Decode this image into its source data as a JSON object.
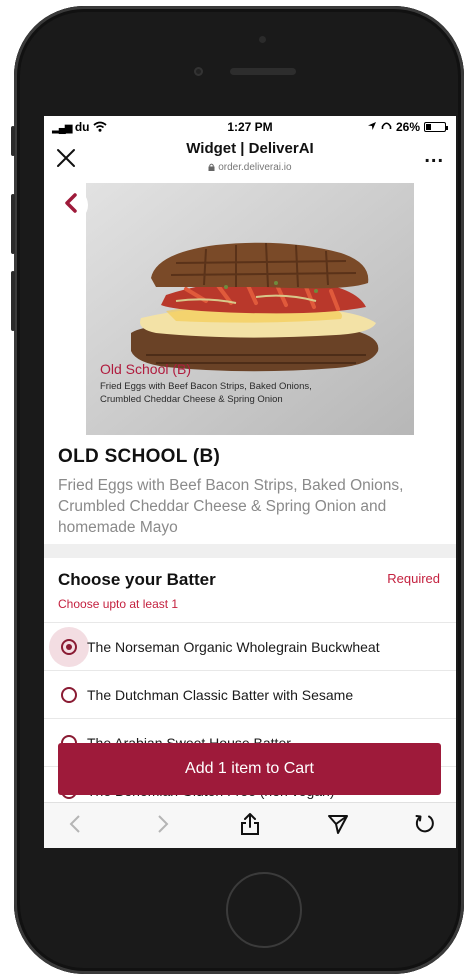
{
  "status_bar": {
    "carrier": "du",
    "time": "1:27 PM",
    "battery": "26%",
    "battery_level": 0.26
  },
  "browser": {
    "title": "Widget | DeliverAI",
    "url": "order.deliverai.io",
    "more_label": "..."
  },
  "hero": {
    "caption_title": "Old School (B)",
    "caption_desc_line1": "Fried Eggs with Beef Bacon Strips, Baked Onions,",
    "caption_desc_line2": "Crumbled Cheddar Cheese & Spring Onion"
  },
  "item": {
    "title": "OLD SCHOOL (B)",
    "description": "Fried Eggs with Beef Bacon Strips, Baked Onions, Crumbled Cheddar Cheese & Spring Onion and homemade Mayo"
  },
  "batter_section": {
    "title": "Choose your Batter",
    "required_label": "Required",
    "subtitle": "Choose upto at least 1",
    "options": [
      {
        "label": "The Norseman Organic Wholegrain Buckwheat",
        "selected": true
      },
      {
        "label": "The Dutchman Classic Batter with Sesame",
        "selected": false
      },
      {
        "label": "The Arabian Sweet House Batter",
        "selected": false
      },
      {
        "label": "The Bohemian Gluten Free (non vegan)",
        "selected": false
      }
    ]
  },
  "cart_button": {
    "label": "Add 1 item to Cart"
  },
  "colors": {
    "brand": "#9e1a3a",
    "accent_red": "#c4213f"
  }
}
